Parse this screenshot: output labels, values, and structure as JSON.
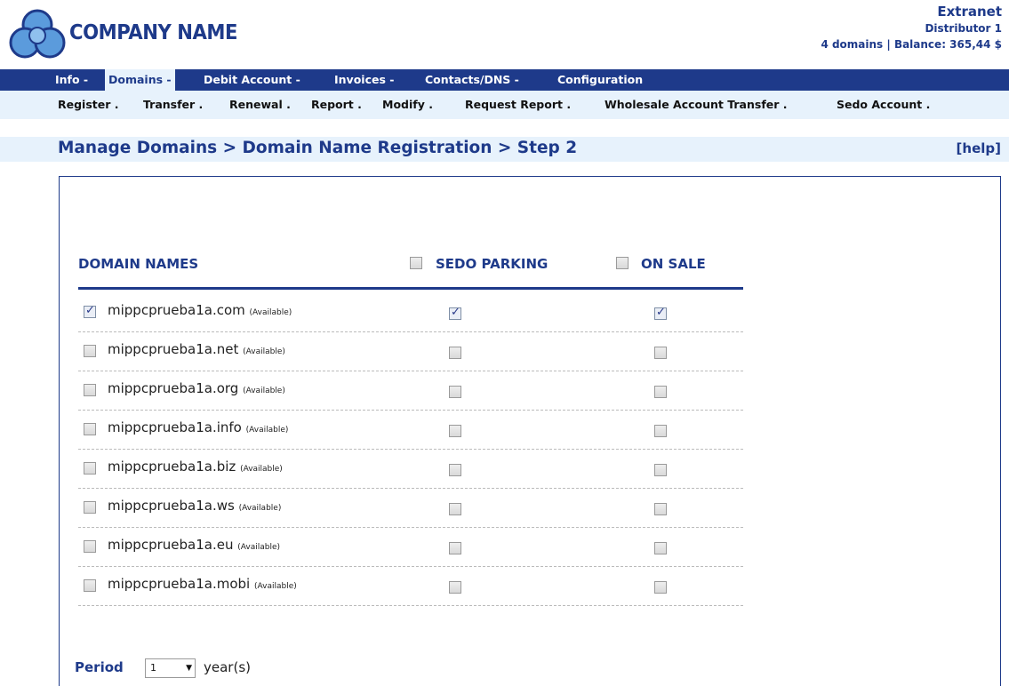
{
  "header": {
    "company_name": "COMPANY NAME",
    "section": "Extranet",
    "distributor": "Distributor 1",
    "balance_line": "4 domains | Balance: 365,44 $"
  },
  "nav_main": [
    {
      "label": "Info -",
      "active": false
    },
    {
      "label": "Domains -",
      "active": true
    },
    {
      "label": "Debit Account -",
      "active": false
    },
    {
      "label": "Invoices -",
      "active": false
    },
    {
      "label": "Contacts/DNS -",
      "active": false
    },
    {
      "label": "Configuration",
      "active": false
    }
  ],
  "nav_sub": [
    {
      "label": "Register ."
    },
    {
      "label": "Transfer ."
    },
    {
      "label": "Renewal ."
    },
    {
      "label": "Report ."
    },
    {
      "label": "Modify ."
    },
    {
      "label": "Request Report ."
    },
    {
      "label": "Wholesale Account Transfer ."
    },
    {
      "label": "Sedo Account ."
    }
  ],
  "page": {
    "title": "Manage Domains > Domain Name Registration  > Step 2",
    "help": "[help]"
  },
  "table": {
    "col_domains": "DOMAIN NAMES",
    "col_sedo": "SEDO PARKING",
    "col_sale": "ON SALE",
    "sedo_all_checked": false,
    "sale_all_checked": false,
    "rows": [
      {
        "name": "mippcprueba1a.com",
        "status": "(Available)",
        "selected": true,
        "sedo": true,
        "sale": true
      },
      {
        "name": "mippcprueba1a.net",
        "status": "(Available)",
        "selected": false,
        "sedo": false,
        "sale": false
      },
      {
        "name": "mippcprueba1a.org",
        "status": "(Available)",
        "selected": false,
        "sedo": false,
        "sale": false
      },
      {
        "name": "mippcprueba1a.info",
        "status": "(Available)",
        "selected": false,
        "sedo": false,
        "sale": false
      },
      {
        "name": "mippcprueba1a.biz",
        "status": "(Available)",
        "selected": false,
        "sedo": false,
        "sale": false
      },
      {
        "name": "mippcprueba1a.ws",
        "status": "(Available)",
        "selected": false,
        "sedo": false,
        "sale": false
      },
      {
        "name": "mippcprueba1a.eu",
        "status": "(Available)",
        "selected": false,
        "sedo": false,
        "sale": false
      },
      {
        "name": "mippcprueba1a.mobi",
        "status": "(Available)",
        "selected": false,
        "sedo": false,
        "sale": false
      }
    ]
  },
  "period": {
    "label": "Period",
    "value": "1",
    "unit": "year(s)"
  },
  "colors": {
    "brand": "#1e3a8a",
    "light": "#e7f2fc"
  }
}
